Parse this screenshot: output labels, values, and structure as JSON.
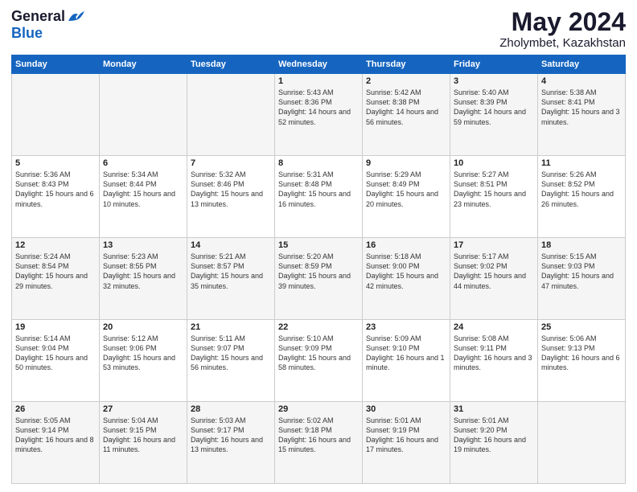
{
  "logo": {
    "general": "General",
    "blue": "Blue"
  },
  "header": {
    "month": "May 2024",
    "location": "Zholymbet, Kazakhstan"
  },
  "weekdays": [
    "Sunday",
    "Monday",
    "Tuesday",
    "Wednesday",
    "Thursday",
    "Friday",
    "Saturday"
  ],
  "weeks": [
    [
      {
        "day": "",
        "sunrise": "",
        "sunset": "",
        "daylight": ""
      },
      {
        "day": "",
        "sunrise": "",
        "sunset": "",
        "daylight": ""
      },
      {
        "day": "",
        "sunrise": "",
        "sunset": "",
        "daylight": ""
      },
      {
        "day": "1",
        "sunrise": "Sunrise: 5:43 AM",
        "sunset": "Sunset: 8:36 PM",
        "daylight": "Daylight: 14 hours and 52 minutes."
      },
      {
        "day": "2",
        "sunrise": "Sunrise: 5:42 AM",
        "sunset": "Sunset: 8:38 PM",
        "daylight": "Daylight: 14 hours and 56 minutes."
      },
      {
        "day": "3",
        "sunrise": "Sunrise: 5:40 AM",
        "sunset": "Sunset: 8:39 PM",
        "daylight": "Daylight: 14 hours and 59 minutes."
      },
      {
        "day": "4",
        "sunrise": "Sunrise: 5:38 AM",
        "sunset": "Sunset: 8:41 PM",
        "daylight": "Daylight: 15 hours and 3 minutes."
      }
    ],
    [
      {
        "day": "5",
        "sunrise": "Sunrise: 5:36 AM",
        "sunset": "Sunset: 8:43 PM",
        "daylight": "Daylight: 15 hours and 6 minutes."
      },
      {
        "day": "6",
        "sunrise": "Sunrise: 5:34 AM",
        "sunset": "Sunset: 8:44 PM",
        "daylight": "Daylight: 15 hours and 10 minutes."
      },
      {
        "day": "7",
        "sunrise": "Sunrise: 5:32 AM",
        "sunset": "Sunset: 8:46 PM",
        "daylight": "Daylight: 15 hours and 13 minutes."
      },
      {
        "day": "8",
        "sunrise": "Sunrise: 5:31 AM",
        "sunset": "Sunset: 8:48 PM",
        "daylight": "Daylight: 15 hours and 16 minutes."
      },
      {
        "day": "9",
        "sunrise": "Sunrise: 5:29 AM",
        "sunset": "Sunset: 8:49 PM",
        "daylight": "Daylight: 15 hours and 20 minutes."
      },
      {
        "day": "10",
        "sunrise": "Sunrise: 5:27 AM",
        "sunset": "Sunset: 8:51 PM",
        "daylight": "Daylight: 15 hours and 23 minutes."
      },
      {
        "day": "11",
        "sunrise": "Sunrise: 5:26 AM",
        "sunset": "Sunset: 8:52 PM",
        "daylight": "Daylight: 15 hours and 26 minutes."
      }
    ],
    [
      {
        "day": "12",
        "sunrise": "Sunrise: 5:24 AM",
        "sunset": "Sunset: 8:54 PM",
        "daylight": "Daylight: 15 hours and 29 minutes."
      },
      {
        "day": "13",
        "sunrise": "Sunrise: 5:23 AM",
        "sunset": "Sunset: 8:55 PM",
        "daylight": "Daylight: 15 hours and 32 minutes."
      },
      {
        "day": "14",
        "sunrise": "Sunrise: 5:21 AM",
        "sunset": "Sunset: 8:57 PM",
        "daylight": "Daylight: 15 hours and 35 minutes."
      },
      {
        "day": "15",
        "sunrise": "Sunrise: 5:20 AM",
        "sunset": "Sunset: 8:59 PM",
        "daylight": "Daylight: 15 hours and 39 minutes."
      },
      {
        "day": "16",
        "sunrise": "Sunrise: 5:18 AM",
        "sunset": "Sunset: 9:00 PM",
        "daylight": "Daylight: 15 hours and 42 minutes."
      },
      {
        "day": "17",
        "sunrise": "Sunrise: 5:17 AM",
        "sunset": "Sunset: 9:02 PM",
        "daylight": "Daylight: 15 hours and 44 minutes."
      },
      {
        "day": "18",
        "sunrise": "Sunrise: 5:15 AM",
        "sunset": "Sunset: 9:03 PM",
        "daylight": "Daylight: 15 hours and 47 minutes."
      }
    ],
    [
      {
        "day": "19",
        "sunrise": "Sunrise: 5:14 AM",
        "sunset": "Sunset: 9:04 PM",
        "daylight": "Daylight: 15 hours and 50 minutes."
      },
      {
        "day": "20",
        "sunrise": "Sunrise: 5:12 AM",
        "sunset": "Sunset: 9:06 PM",
        "daylight": "Daylight: 15 hours and 53 minutes."
      },
      {
        "day": "21",
        "sunrise": "Sunrise: 5:11 AM",
        "sunset": "Sunset: 9:07 PM",
        "daylight": "Daylight: 15 hours and 56 minutes."
      },
      {
        "day": "22",
        "sunrise": "Sunrise: 5:10 AM",
        "sunset": "Sunset: 9:09 PM",
        "daylight": "Daylight: 15 hours and 58 minutes."
      },
      {
        "day": "23",
        "sunrise": "Sunrise: 5:09 AM",
        "sunset": "Sunset: 9:10 PM",
        "daylight": "Daylight: 16 hours and 1 minute."
      },
      {
        "day": "24",
        "sunrise": "Sunrise: 5:08 AM",
        "sunset": "Sunset: 9:11 PM",
        "daylight": "Daylight: 16 hours and 3 minutes."
      },
      {
        "day": "25",
        "sunrise": "Sunrise: 5:06 AM",
        "sunset": "Sunset: 9:13 PM",
        "daylight": "Daylight: 16 hours and 6 minutes."
      }
    ],
    [
      {
        "day": "26",
        "sunrise": "Sunrise: 5:05 AM",
        "sunset": "Sunset: 9:14 PM",
        "daylight": "Daylight: 16 hours and 8 minutes."
      },
      {
        "day": "27",
        "sunrise": "Sunrise: 5:04 AM",
        "sunset": "Sunset: 9:15 PM",
        "daylight": "Daylight: 16 hours and 11 minutes."
      },
      {
        "day": "28",
        "sunrise": "Sunrise: 5:03 AM",
        "sunset": "Sunset: 9:17 PM",
        "daylight": "Daylight: 16 hours and 13 minutes."
      },
      {
        "day": "29",
        "sunrise": "Sunrise: 5:02 AM",
        "sunset": "Sunset: 9:18 PM",
        "daylight": "Daylight: 16 hours and 15 minutes."
      },
      {
        "day": "30",
        "sunrise": "Sunrise: 5:01 AM",
        "sunset": "Sunset: 9:19 PM",
        "daylight": "Daylight: 16 hours and 17 minutes."
      },
      {
        "day": "31",
        "sunrise": "Sunrise: 5:01 AM",
        "sunset": "Sunset: 9:20 PM",
        "daylight": "Daylight: 16 hours and 19 minutes."
      },
      {
        "day": "",
        "sunrise": "",
        "sunset": "",
        "daylight": ""
      }
    ]
  ]
}
